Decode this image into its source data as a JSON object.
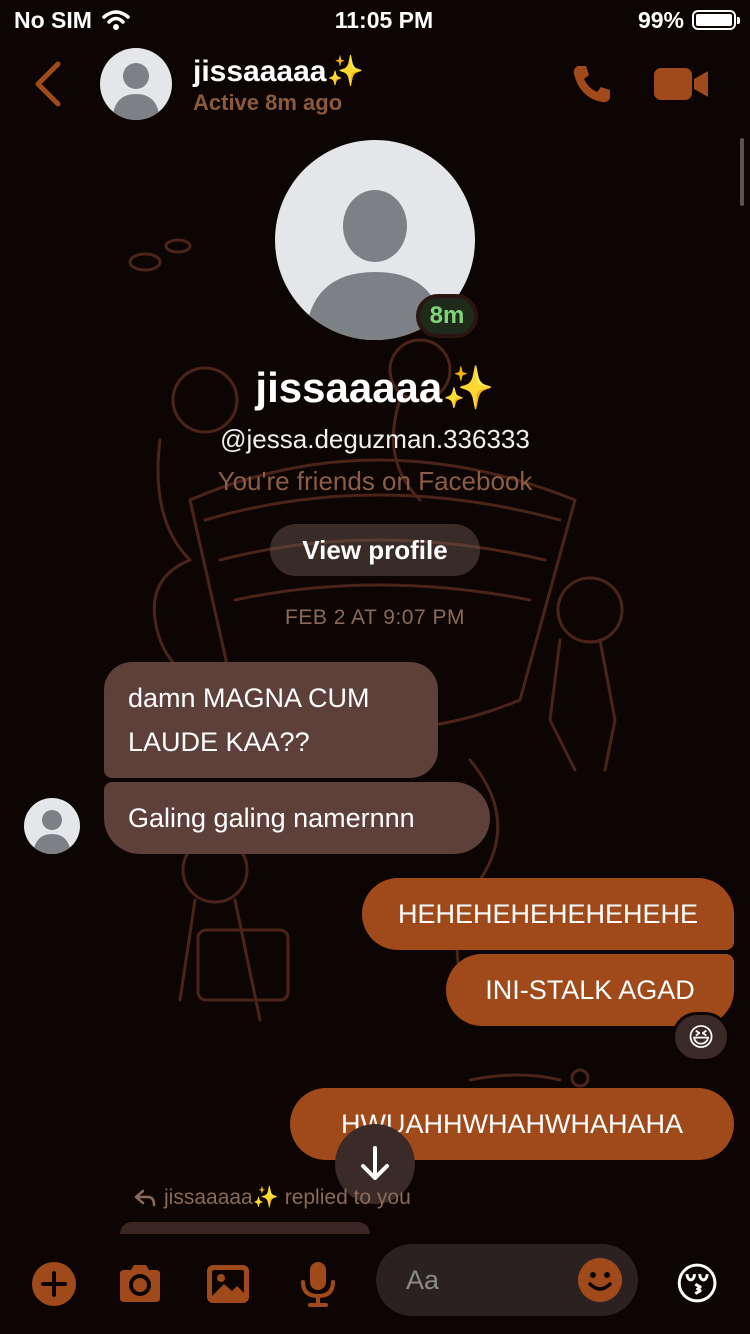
{
  "status_bar": {
    "carrier": "No SIM",
    "time": "11:05 PM",
    "battery": "99%",
    "battery_level": 0.99
  },
  "header": {
    "contact_name": "jissaaaaa✨",
    "active_status": "Active 8m ago"
  },
  "profile": {
    "name": "jissaaaaa✨",
    "handle": "@jessa.deguzman.336333",
    "friends_note": "You're friends on Facebook",
    "active_badge": "8m",
    "view_profile_label": "View profile"
  },
  "conversation": {
    "timestamp": "FEB 2 AT 9:07 PM",
    "messages": [
      {
        "direction": "incoming",
        "text": "damn MAGNA CUM LAUDE KAA??"
      },
      {
        "direction": "incoming",
        "text": "Galing galing namernnn"
      },
      {
        "direction": "outgoing",
        "text": "HEHEHEHEHEHEHEHE"
      },
      {
        "direction": "outgoing",
        "text": "INI-STALK AGAD",
        "reaction": "😆"
      },
      {
        "direction": "outgoing",
        "text": "HWUAHHWHAHWHAHAHA"
      }
    ],
    "reply_note": "jissaaaaa✨ replied to you"
  },
  "composer": {
    "placeholder": "Aa",
    "quick_reaction": "😚"
  },
  "colors": {
    "accent": "#a04a1b",
    "incoming_bubble": "#5e403b",
    "background": "#0d0504"
  },
  "icons": [
    "back-arrow-icon",
    "phone-icon",
    "video-camera-icon",
    "plus-icon",
    "camera-icon",
    "photo-icon",
    "microphone-icon",
    "smiley-icon",
    "arrow-down-icon",
    "reply-arrow-icon"
  ]
}
